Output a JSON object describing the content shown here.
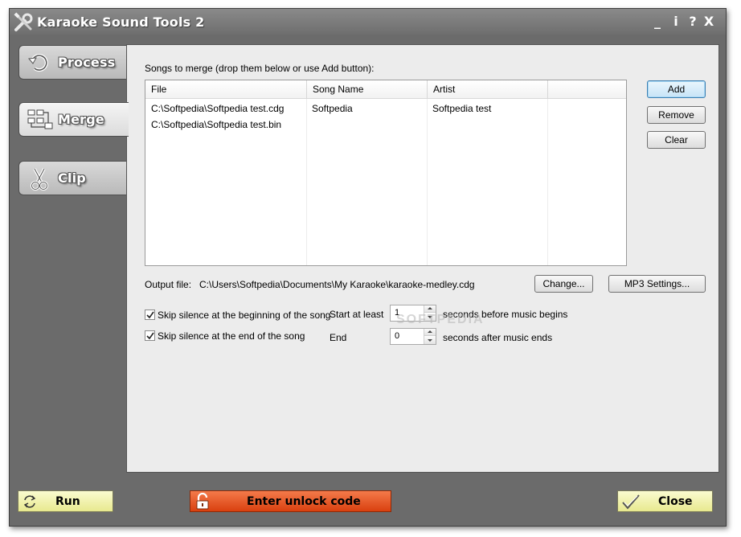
{
  "app": {
    "title": "Karaoke Sound Tools 2",
    "title_buttons": [
      "_",
      "i",
      "?",
      "X"
    ]
  },
  "tabs": [
    {
      "label": "Process",
      "icon": "process-icon"
    },
    {
      "label": "Merge",
      "icon": "merge-icon",
      "active": true
    },
    {
      "label": "Clip",
      "icon": "scissors-icon"
    }
  ],
  "merge": {
    "heading": "Songs to merge (drop them below or use Add button):",
    "columns": [
      "File",
      "Song Name",
      "Artist",
      ""
    ],
    "rows": [
      {
        "file": "C:\\Softpedia\\Softpedia test.cdg",
        "song": "Softpedia",
        "artist": "Softpedia test"
      },
      {
        "file": "C:\\Softpedia\\Softpedia test.bin",
        "song": "",
        "artist": ""
      }
    ],
    "buttons": {
      "add": "Add",
      "remove": "Remove",
      "clear": "Clear"
    },
    "output_label": "Output file:",
    "output_path": "C:\\Users\\Softpedia\\Documents\\My Karaoke\\karaoke-medley.cdg",
    "change_button": "Change...",
    "mp3_button": "MP3 Settings...",
    "skip_start": {
      "label": "Skip silence at the beginning of the song",
      "checked": true,
      "prefix": "Start at least",
      "value": "1",
      "suffix": "seconds before music begins"
    },
    "skip_end": {
      "label": "Skip silence at the end of the song",
      "checked": true,
      "prefix": "End",
      "value": "0",
      "suffix": "seconds after music ends"
    },
    "watermark": "SOFTPEDIA"
  },
  "footer": {
    "run": "Run",
    "unlock": "Enter unlock code",
    "close": "Close"
  },
  "colors": {
    "unlock_bg": "#e55a26",
    "footer_btn_bg": "#eeef9a",
    "window_bg": "#6b6b6b"
  }
}
